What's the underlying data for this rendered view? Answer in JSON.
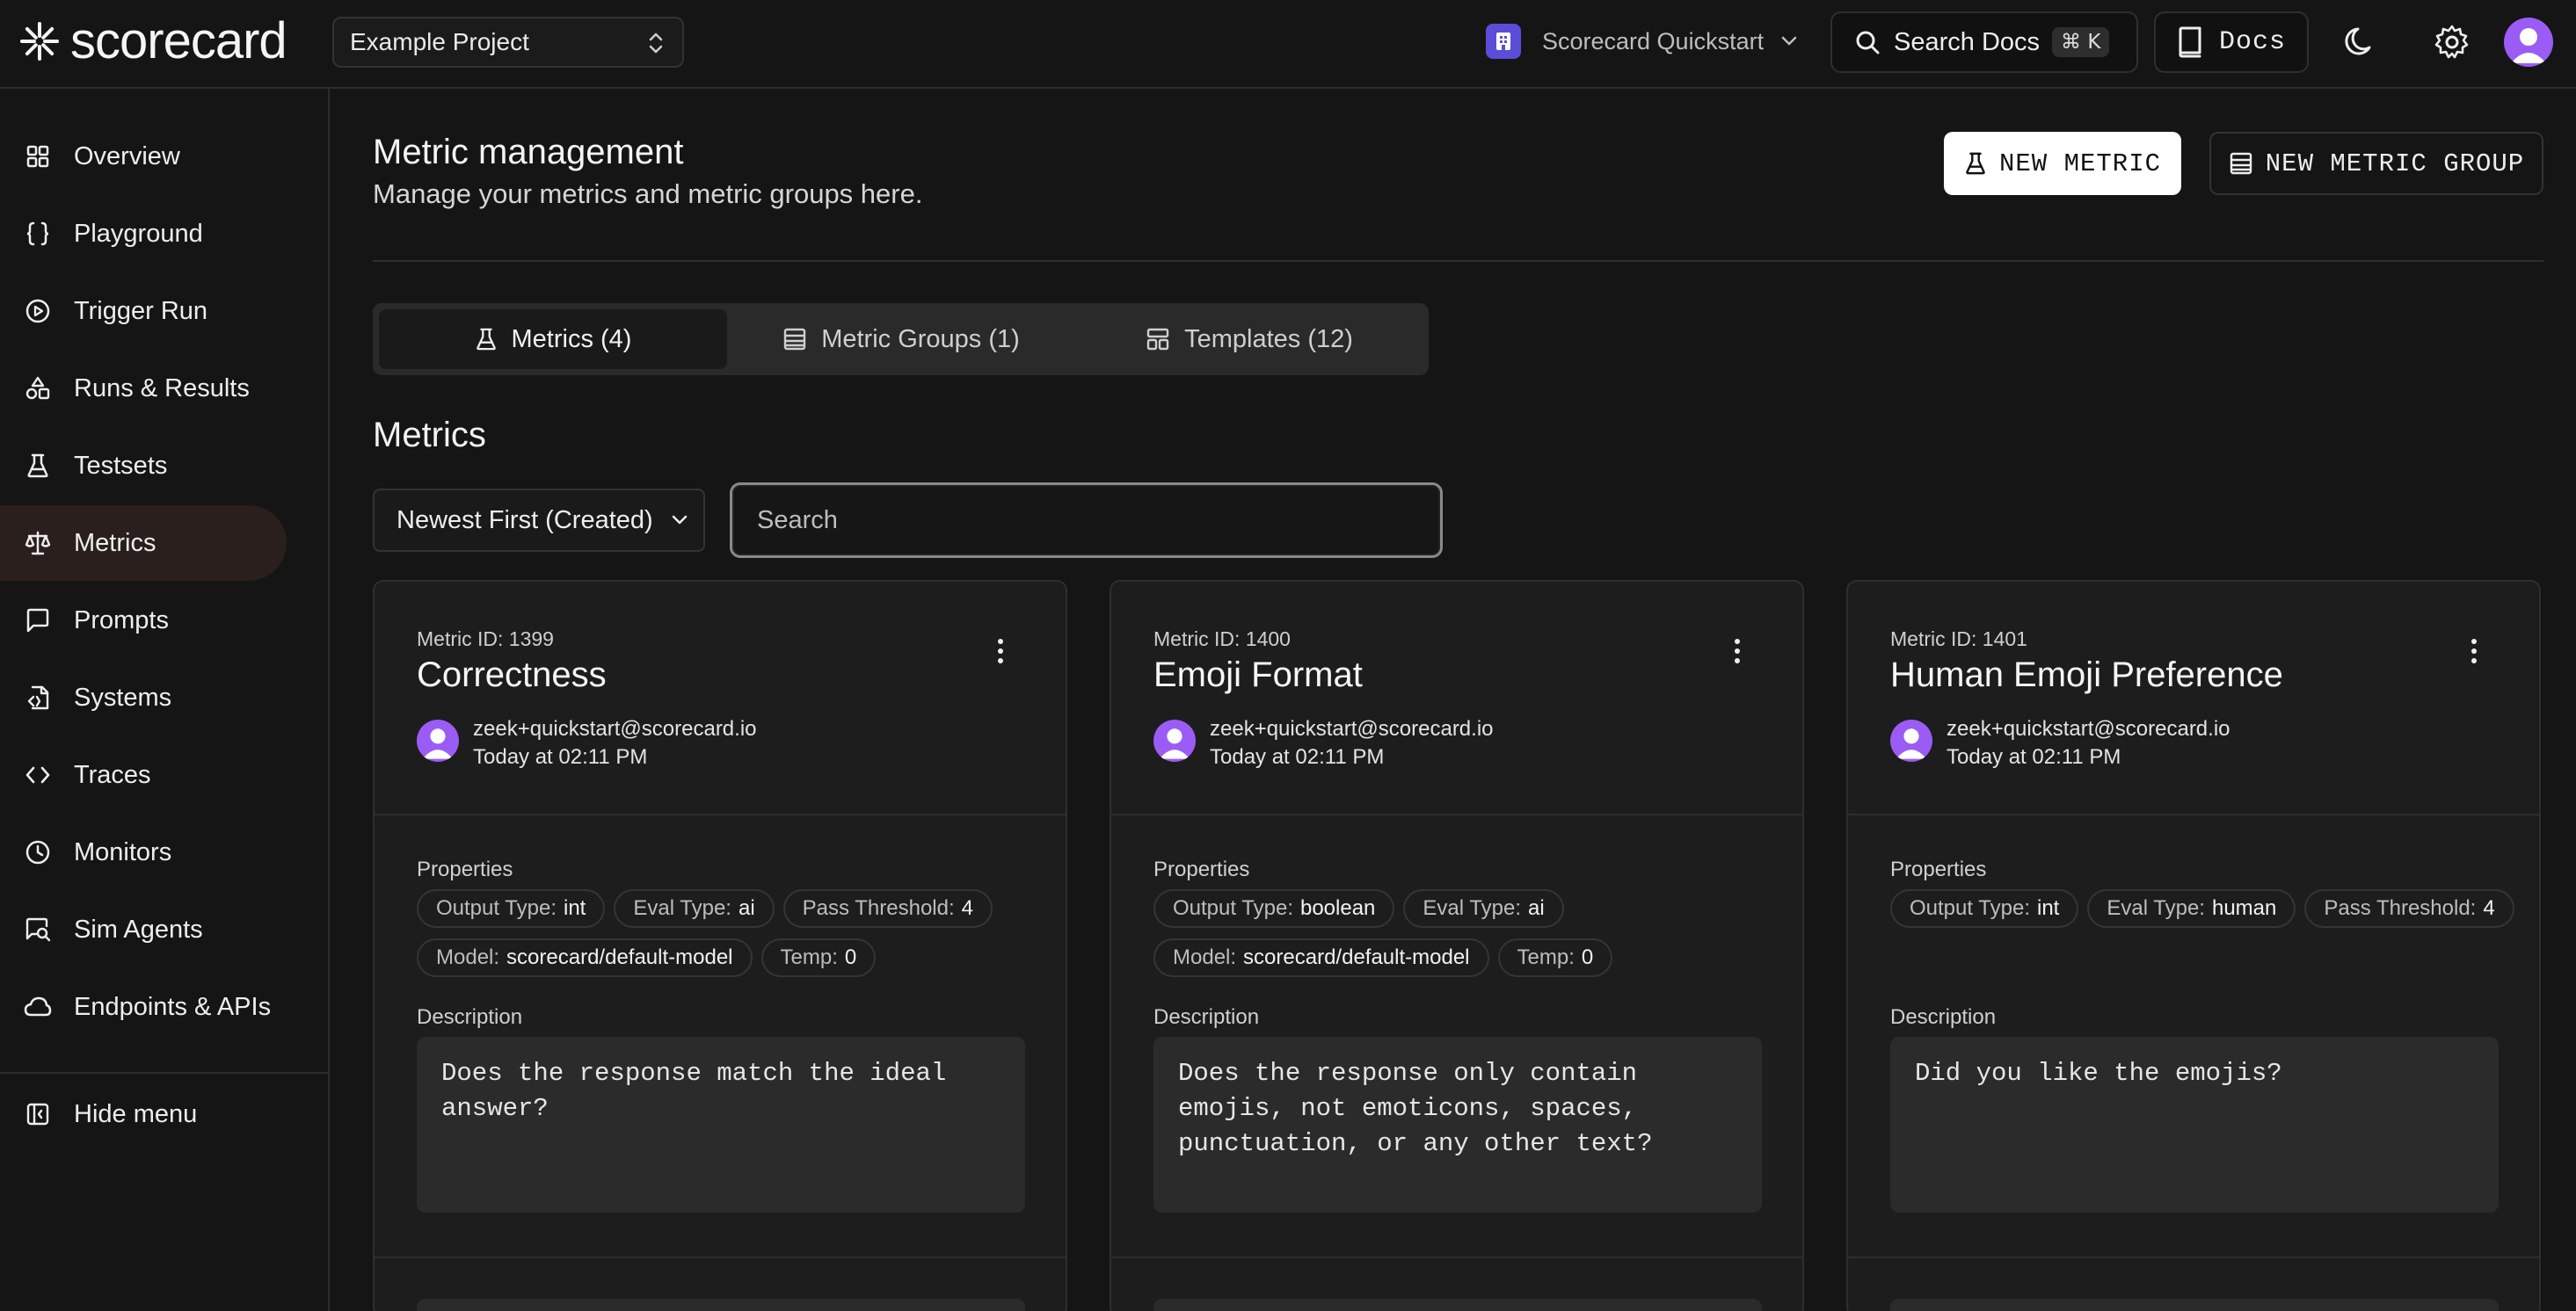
{
  "app": {
    "brand": "scorecard"
  },
  "project": {
    "name": "Example Project"
  },
  "org": {
    "name": "Scorecard Quickstart"
  },
  "search_docs": {
    "label": "Search Docs",
    "shortcut": "⌘ K"
  },
  "docs_button": {
    "label": "Docs"
  },
  "sidebar": {
    "items": [
      {
        "label": "Overview",
        "icon": "grid-icon"
      },
      {
        "label": "Playground",
        "icon": "braces-icon"
      },
      {
        "label": "Trigger Run",
        "icon": "play-circle-icon"
      },
      {
        "label": "Runs & Results",
        "icon": "shapes-icon"
      },
      {
        "label": "Testsets",
        "icon": "flask-icon"
      },
      {
        "label": "Metrics",
        "icon": "scale-icon",
        "active": true
      },
      {
        "label": "Prompts",
        "icon": "message-icon"
      },
      {
        "label": "Systems",
        "icon": "file-code-icon"
      },
      {
        "label": "Traces",
        "icon": "code-icon"
      },
      {
        "label": "Monitors",
        "icon": "clock-icon"
      },
      {
        "label": "Sim Agents",
        "icon": "chat-search-icon"
      },
      {
        "label": "Endpoints & APIs",
        "icon": "cloud-icon"
      }
    ],
    "hide_menu": "Hide menu"
  },
  "header": {
    "title": "Metric management",
    "subtitle": "Manage your metrics and metric groups here.",
    "new_metric": "NEW METRIC",
    "new_metric_group": "NEW METRIC GROUP"
  },
  "tabs": [
    {
      "label": "Metrics (4)",
      "active": true
    },
    {
      "label": "Metric Groups (1)"
    },
    {
      "label": "Templates (12)"
    }
  ],
  "metrics_section": {
    "title": "Metrics",
    "sort": "Newest First (Created)",
    "search_placeholder": "Search"
  },
  "cards": [
    {
      "id_label": "Metric ID: 1399",
      "name": "Correctness",
      "author": "zeek+quickstart@scorecard.io",
      "time": "Today at 02:11 PM",
      "properties_label": "Properties",
      "properties": [
        {
          "key": "Output Type:",
          "value": "int"
        },
        {
          "key": "Eval Type:",
          "value": "ai"
        },
        {
          "key": "Pass Threshold:",
          "value": "4"
        },
        {
          "key": "Model:",
          "value": "scorecard/default-model"
        },
        {
          "key": "Temp:",
          "value": "0"
        }
      ],
      "description_label": "Description",
      "description": "Does the response match the ideal answer?"
    },
    {
      "id_label": "Metric ID: 1400",
      "name": "Emoji Format",
      "author": "zeek+quickstart@scorecard.io",
      "time": "Today at 02:11 PM",
      "properties_label": "Properties",
      "properties": [
        {
          "key": "Output Type:",
          "value": "boolean"
        },
        {
          "key": "Eval Type:",
          "value": "ai"
        },
        {
          "key": "Model:",
          "value": "scorecard/default-model"
        },
        {
          "key": "Temp:",
          "value": "0"
        }
      ],
      "description_label": "Description",
      "description": "Does the response only contain emojis, not emoticons, spaces, punctuation, or any other text?"
    },
    {
      "id_label": "Metric ID: 1401",
      "name": "Human Emoji Preference",
      "author": "zeek+quickstart@scorecard.io",
      "time": "Today at 02:11 PM",
      "properties_label": "Properties",
      "properties": [
        {
          "key": "Output Type:",
          "value": "int"
        },
        {
          "key": "Eval Type:",
          "value": "human"
        },
        {
          "key": "Pass Threshold:",
          "value": "4"
        }
      ],
      "description_label": "Description",
      "description": "Did you like the emojis?"
    }
  ],
  "colors": {
    "accent": "#9b5cf6",
    "org_badge": "#5b4dd8",
    "active_nav": "#2a1f1c",
    "background": "#151515"
  }
}
